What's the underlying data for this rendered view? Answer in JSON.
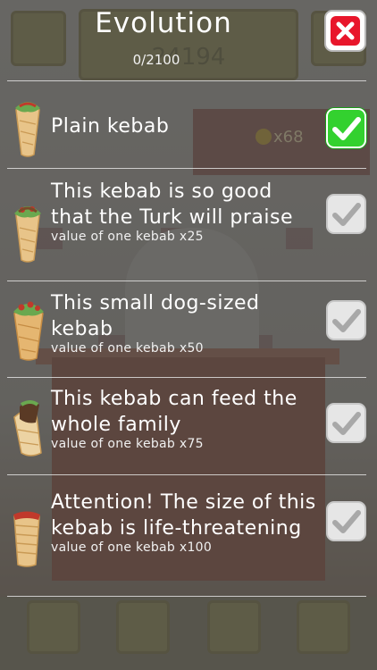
{
  "background": {
    "counter_value": "24194",
    "shop_count": "x68"
  },
  "modal": {
    "title": "Evolution",
    "progress": "0/2100",
    "close_icon": "close-icon",
    "accent_color": "#e8162b",
    "selected_color": "#33d12f",
    "items": [
      {
        "name": "Plain kebab",
        "value": "",
        "selected": true,
        "icon": "kebab-icon"
      },
      {
        "name": "This kebab is so good that the Turk will praise",
        "value": "value of one kebab x25",
        "selected": false,
        "icon": "kebab-icon"
      },
      {
        "name": "This small dog-sized kebab",
        "value": "value of one kebab x50",
        "selected": false,
        "icon": "kebab-icon"
      },
      {
        "name": "This kebab can feed the whole family",
        "value": "value of one kebab x75",
        "selected": false,
        "icon": "kebab-icon"
      },
      {
        "name": "Attention! The size of this kebab is life-threatening",
        "value": "value of one kebab x100",
        "selected": false,
        "icon": "kebab-icon"
      }
    ]
  }
}
